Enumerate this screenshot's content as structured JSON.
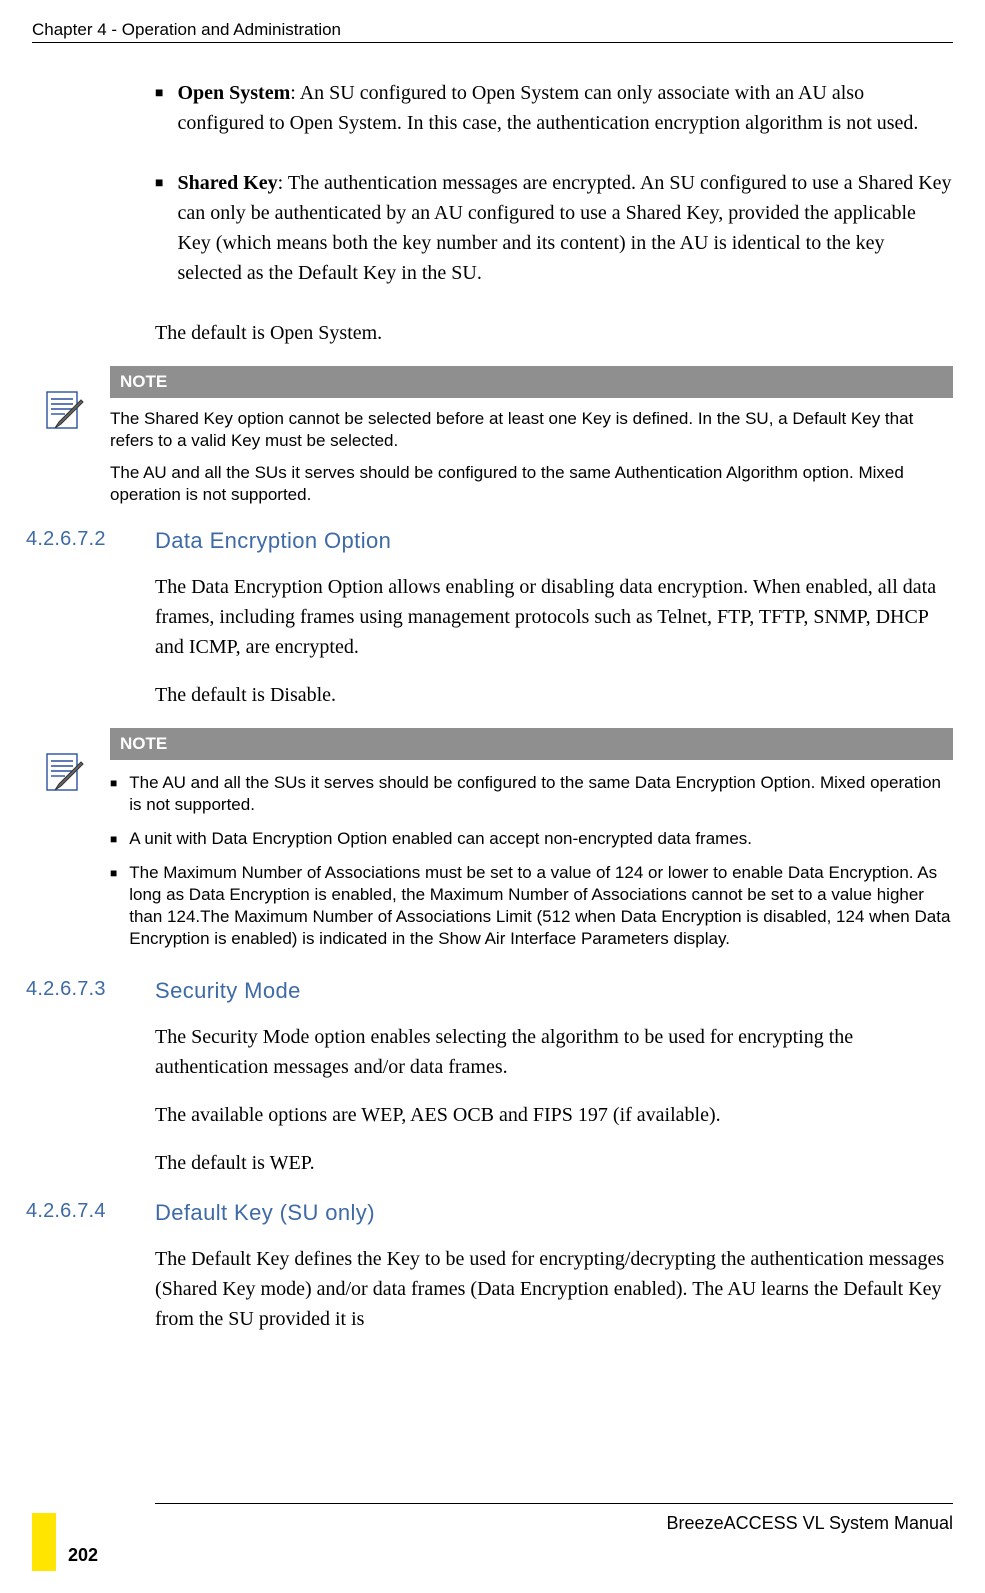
{
  "header": {
    "chapter": "Chapter 4 - Operation and Administration"
  },
  "bullets": {
    "open_system": {
      "title": "Open System",
      "text": ": An SU configured to Open System can only associate with an AU also configured to Open System. In this case, the authentication encryption algorithm is not used."
    },
    "shared_key": {
      "title": "Shared Key",
      "text": ": The authentication messages are encrypted. An SU configured to use a Shared Key can only be authenticated by an AU configured to use a Shared Key, provided the applicable Key (which means both the key number and its content) in the AU is identical to the key selected as the Default Key in the SU."
    }
  },
  "default_open": "The default is Open System.",
  "note1": {
    "label": "NOTE",
    "p1": "The Shared Key option cannot be selected before at least one Key is defined. In the SU, a Default Key that refers to a valid Key must be selected.",
    "p2": "The AU and all the SUs it serves should be configured to the same Authentication Algorithm option. Mixed operation is not supported."
  },
  "sections": {
    "s2": {
      "num": "4.2.6.7.2",
      "title": "Data Encryption Option",
      "p1": "The Data Encryption Option allows enabling or disabling data encryption. When enabled, all data frames, including frames using management protocols such as Telnet, FTP, TFTP, SNMP, DHCP and ICMP, are encrypted.",
      "p2": "The default is Disable."
    },
    "s3": {
      "num": "4.2.6.7.3",
      "title": "Security Mode",
      "p1": "The Security Mode option enables selecting the algorithm to be used for encrypting the authentication messages and/or data frames.",
      "p2": "The available options are WEP, AES OCB and FIPS 197 (if available).",
      "p3": "The default is WEP."
    },
    "s4": {
      "num": "4.2.6.7.4",
      "title": "Default Key (SU only)",
      "p1": "The Default Key defines the Key to be used for encrypting/decrypting the authentication messages (Shared Key mode) and/or data frames (Data Encryption enabled). The AU learns the Default Key from the SU provided it is"
    }
  },
  "note2": {
    "label": "NOTE",
    "b1": "The AU and all the SUs it serves should be configured to the same Data Encryption Option. Mixed operation is not supported.",
    "b2": "A unit with Data Encryption Option enabled can accept non-encrypted data frames.",
    "b3": "The Maximum Number of Associations must be set to a value of 124 or lower to enable Data Encryption. As long as Data Encryption is enabled, the Maximum Number of Associations cannot be set to a value higher than 124.The Maximum Number of Associations Limit (512 when Data Encryption is disabled, 124 when Data Encryption is enabled) is indicated in the Show Air Interface Parameters display."
  },
  "footer": {
    "manual": "BreezeACCESS VL System Manual",
    "page": "202"
  }
}
